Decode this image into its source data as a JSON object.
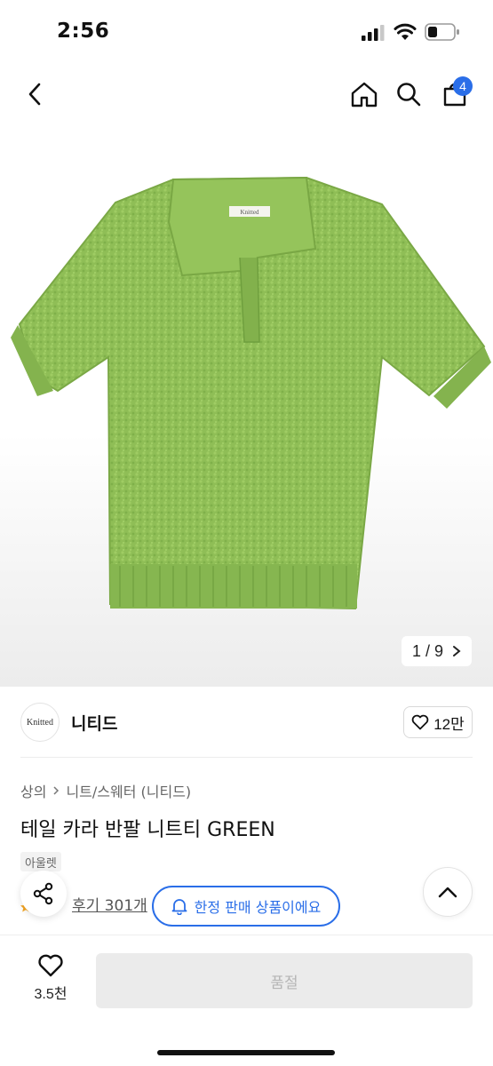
{
  "status_bar": {
    "time": "2:56"
  },
  "nav": {
    "cart_count": "4"
  },
  "gallery": {
    "counter": "1 / 9",
    "label_tag": "Knitted"
  },
  "brand": {
    "logo_text": "Knitted",
    "name": "니티드",
    "likes": "12만"
  },
  "product": {
    "breadcrumb": [
      "상의",
      "니트/스웨터 (니티드)"
    ],
    "title": "테일 카라 반팔 니트티 GREEN",
    "badge": "아울렛",
    "review_link": "후기 301개",
    "limited_label": "한정 판매 상품이에요"
  },
  "bottom": {
    "wish_count": "3.5천",
    "soldout_label": "품절"
  },
  "colors": {
    "accent": "#2a6ee8",
    "sweater": "#8fbe56",
    "soldout_bg": "#ebebeb"
  },
  "icons": [
    "back-icon",
    "home-icon",
    "search-icon",
    "cart-icon",
    "chevron-right-icon",
    "heart-icon",
    "bell-icon",
    "share-icon",
    "chevron-up-icon"
  ]
}
